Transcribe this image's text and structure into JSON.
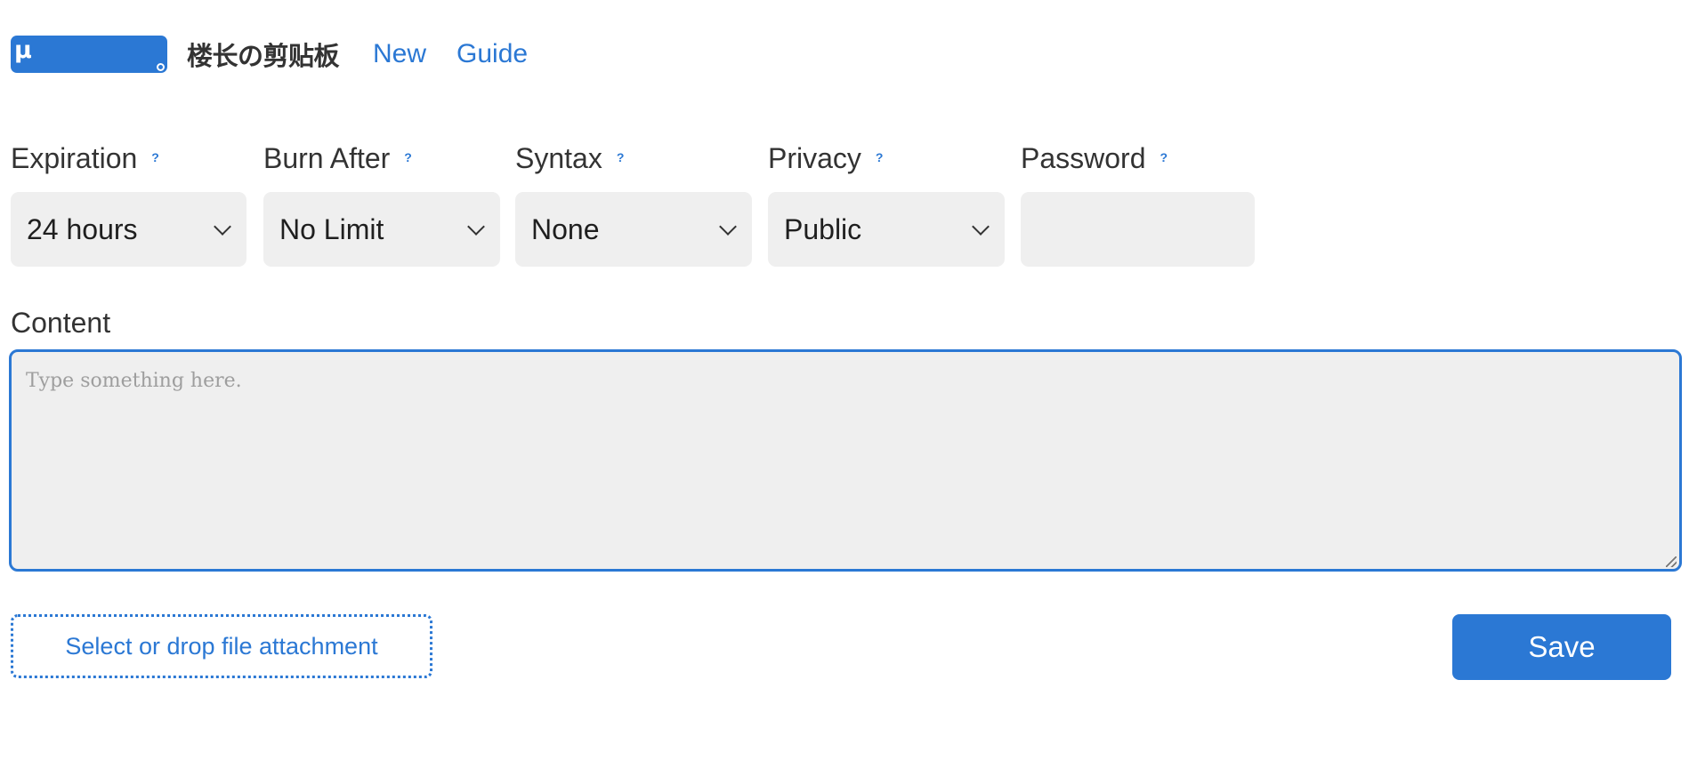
{
  "header": {
    "logo_glyph": "μ",
    "site_title": "楼长の剪贴板",
    "nav": {
      "new_label": "New",
      "guide_label": "Guide"
    }
  },
  "options": {
    "expiration": {
      "label": "Expiration",
      "help": "?",
      "value": "24 hours"
    },
    "burn_after": {
      "label": "Burn After",
      "help": "?",
      "value": "No Limit"
    },
    "syntax": {
      "label": "Syntax",
      "help": "?",
      "value": "None"
    },
    "privacy": {
      "label": "Privacy",
      "help": "?",
      "value": "Public"
    },
    "password": {
      "label": "Password",
      "help": "?",
      "value": ""
    }
  },
  "content": {
    "label": "Content",
    "placeholder": "Type something here.",
    "value": ""
  },
  "attachment": {
    "label": "Select or drop file attachment"
  },
  "actions": {
    "save_label": "Save"
  },
  "icons": {
    "select_arrow": "chevron-down-icon",
    "resize": "resize-grip-icon"
  },
  "colors": {
    "accent": "#2b78d4",
    "field_background": "#efefef",
    "text": "#2b2b2b"
  }
}
